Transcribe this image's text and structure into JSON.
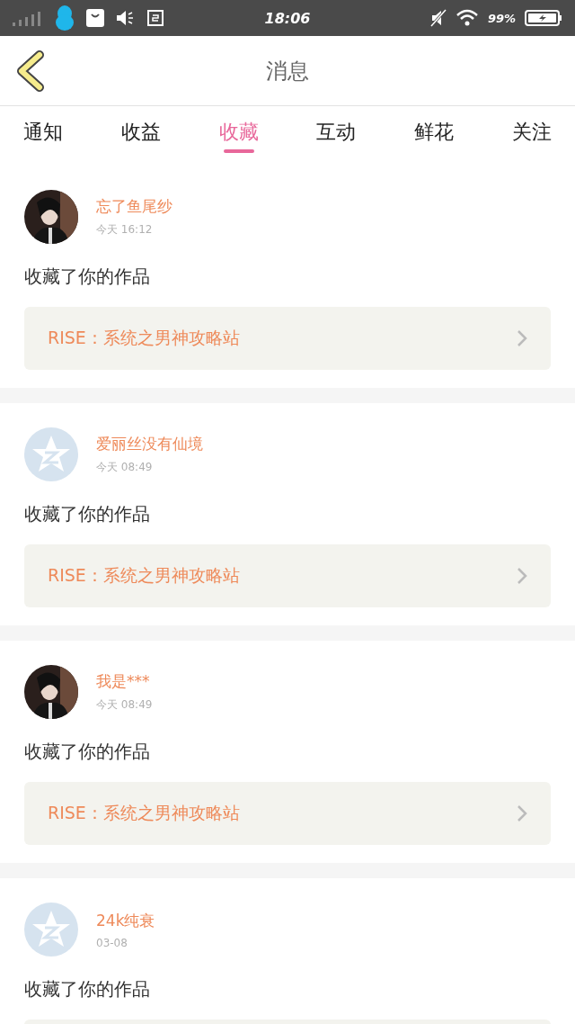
{
  "status_bar": {
    "time": "18:06",
    "battery": "99%"
  },
  "header": {
    "title": "消息"
  },
  "tabs": [
    {
      "label": "通知",
      "selected": false
    },
    {
      "label": "收益",
      "selected": false
    },
    {
      "label": "收藏",
      "selected": true
    },
    {
      "label": "互动",
      "selected": false
    },
    {
      "label": "鲜花",
      "selected": false
    },
    {
      "label": "关注",
      "selected": false
    }
  ],
  "messages": [
    {
      "name": "忘了鱼尾纱",
      "time": "今天 16:12",
      "action": "收藏了你的作品",
      "work": "RISE：系统之男神攻略站"
    },
    {
      "kind": "default",
      "name": "爱丽丝没有仙境",
      "time": "今天 08:49",
      "action": "收藏了你的作品",
      "work": "RISE：系统之男神攻略站"
    },
    {
      "name": "我是***",
      "time": "今天 08:49",
      "action": "收藏了你的作品",
      "work": "RISE：系统之男神攻略站"
    },
    {
      "kind": "default",
      "name": "24k纯衰",
      "time": "03-08",
      "action": "收藏了你的作品"
    }
  ]
}
